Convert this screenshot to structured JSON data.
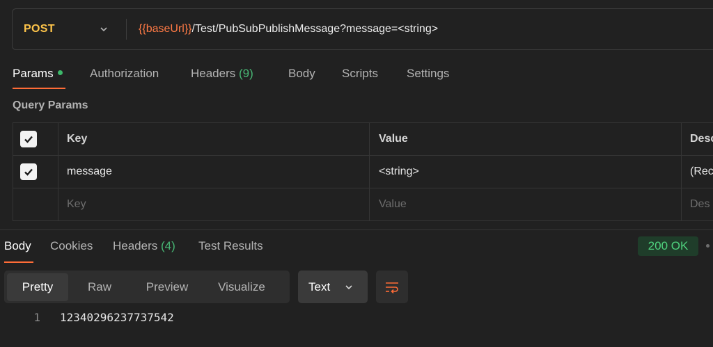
{
  "request": {
    "method": "POST",
    "url_var": "{{baseUrl}}",
    "url_path": "/Test/PubSubPublishMessage?message=<string>"
  },
  "request_tabs": [
    {
      "label": "Params",
      "active": true,
      "dot": true
    },
    {
      "label": "Authorization"
    },
    {
      "label": "Headers",
      "count": "(9)"
    },
    {
      "label": "Body"
    },
    {
      "label": "Scripts"
    },
    {
      "label": "Settings"
    }
  ],
  "query_params": {
    "title": "Query Params",
    "headers": {
      "key": "Key",
      "value": "Value",
      "description": "Desc"
    },
    "rows": [
      {
        "checked": true,
        "key": "message",
        "value": "<string>",
        "description": "(Rec"
      }
    ],
    "placeholder": {
      "key": "Key",
      "value": "Value",
      "description": "Des"
    }
  },
  "response_tabs": [
    {
      "label": "Body",
      "active": true
    },
    {
      "label": "Cookies"
    },
    {
      "label": "Headers",
      "count": "(4)"
    },
    {
      "label": "Test Results"
    }
  ],
  "status": "200 OK",
  "view_modes": [
    "Pretty",
    "Raw",
    "Preview",
    "Visualize"
  ],
  "active_view": "Pretty",
  "format": "Text",
  "body_lines": [
    {
      "n": "1",
      "text": "12340296237737542"
    }
  ],
  "colors": {
    "accent": "#ff6c37",
    "method": "#ffc54a",
    "variable": "#ff7a45",
    "success": "#4fd27e"
  }
}
